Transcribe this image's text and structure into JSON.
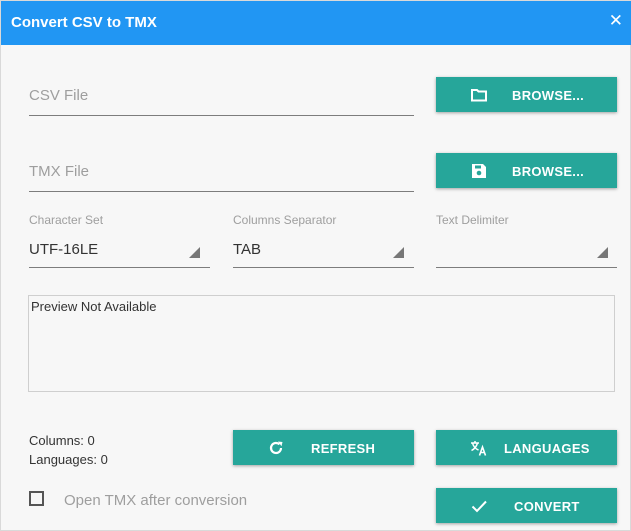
{
  "window": {
    "title": "Convert CSV to TMX",
    "close_glyph": "✕"
  },
  "csv": {
    "placeholder": "CSV File",
    "browse_label": "BROWSE...",
    "icon": "folder-icon"
  },
  "tmx": {
    "placeholder": "TMX File",
    "browse_label": "BROWSE...",
    "icon": "save-icon"
  },
  "charset": {
    "label": "Character Set",
    "value": "UTF-16LE"
  },
  "separator": {
    "label": "Columns Separator",
    "value": "TAB"
  },
  "delimiter": {
    "label": "Text Delimiter",
    "value": ""
  },
  "preview": {
    "text": "Preview Not Available"
  },
  "stats": {
    "columns": "Columns: 0",
    "languages": "Languages: 0"
  },
  "buttons": {
    "refresh": "REFRESH",
    "languages": "LANGUAGES",
    "convert": "CONVERT"
  },
  "options": {
    "open_after": "Open TMX after conversion",
    "open_after_checked": false
  },
  "colors": {
    "titlebar": "#2196f3",
    "button": "#26a69a",
    "background": "#f7f7f7"
  }
}
